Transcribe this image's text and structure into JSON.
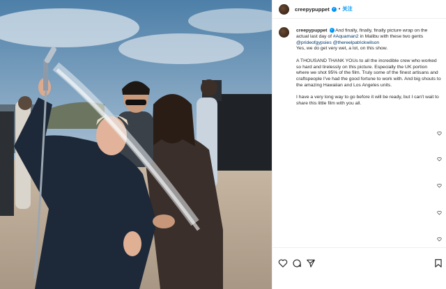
{
  "post": {
    "username": "creepypuppet",
    "follow_label": "关注",
    "caption_para1_prefix": " And finally, finally, finally picture wrap on the actual last day of ",
    "caption_hashtag": "#Aquaman2",
    "caption_para1_mid": " in Malibu with these two gents ",
    "caption_mention1": "@prideofgypsies",
    "caption_mention2": "@thereelpatrickwilson",
    "caption_para1_end": "Yes, we do get very wet, a lot, on this show.",
    "caption_para2": "A THOUSAND THANK YOUs to all the incredible crew who worked so hard and tirelessly on this picture. Especially the UK portion where we shot 95% of the film. Truly some of the finest artisans and craftspeople I've had the good fortune to work with. And big shouts to the amazing Hawaiian and Los Angeles units.",
    "caption_para3": "I have a very long way to go before it will be ready, but I can't wait to share this little film with you all."
  },
  "icons": [
    "more-icon",
    "verified-icon",
    "heart-icon",
    "comment-icon",
    "share-icon",
    "bookmark-icon"
  ],
  "colors": {
    "accent": "#0095f6",
    "text": "#262626",
    "link": "#00376b",
    "border": "#efefef"
  }
}
